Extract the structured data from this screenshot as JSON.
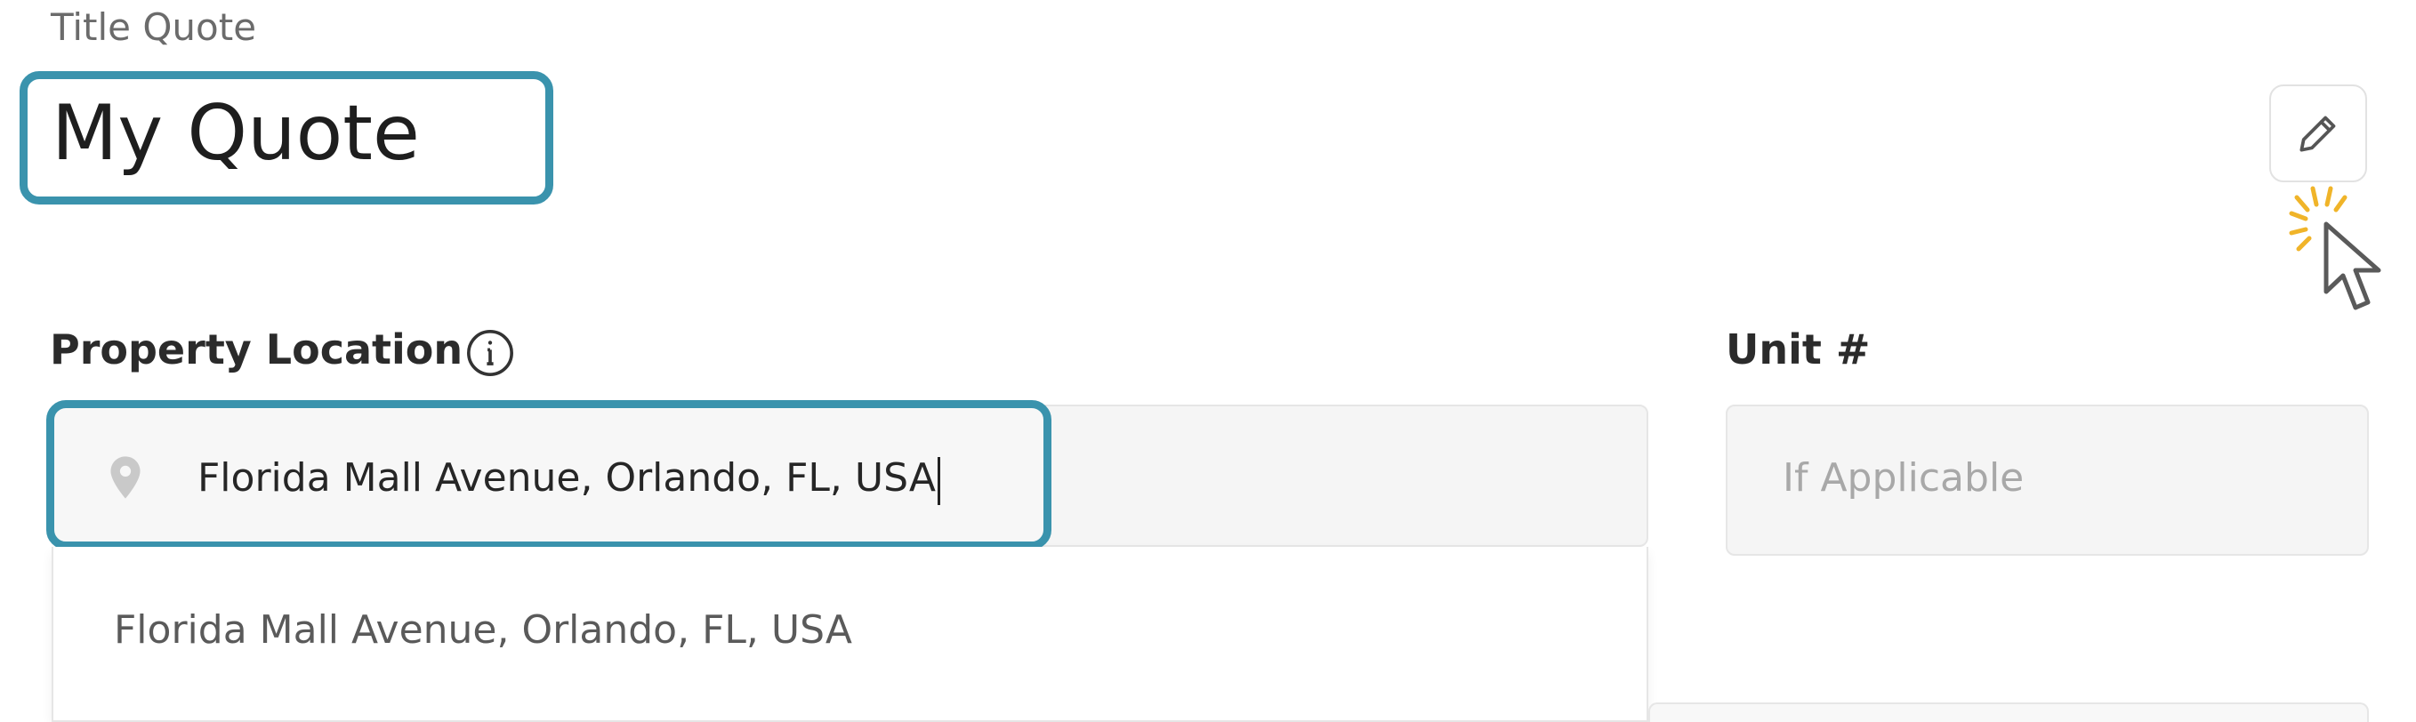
{
  "title_section": {
    "label": "Title Quote",
    "value": "My Quote"
  },
  "property_location": {
    "label": "Property Location",
    "info_icon": "info-icon",
    "pin_icon": "map-pin-icon",
    "value": "Florida Mall Avenue, Orlando, FL, USA",
    "suggestions": [
      "Florida Mall Avenue, Orlando, FL, USA"
    ]
  },
  "unit": {
    "label": "Unit #",
    "placeholder": "If Applicable"
  },
  "toolbar": {
    "edit_icon": "pencil-icon"
  },
  "colors": {
    "focus_ring": "#3a93ad",
    "field_bg": "#f5f5f5",
    "click_highlight": "#f0b429"
  }
}
